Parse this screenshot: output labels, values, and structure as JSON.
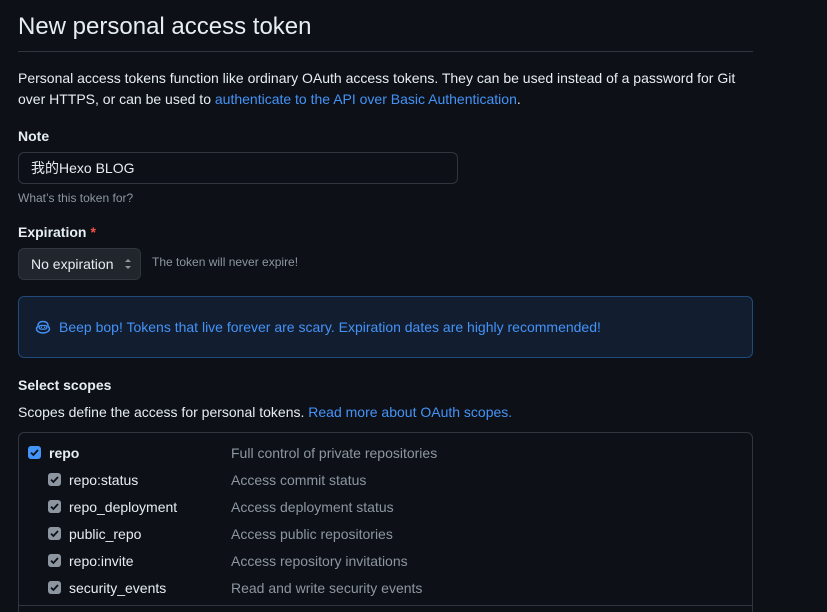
{
  "page": {
    "title": "New personal access token",
    "intro_text": "Personal access tokens function like ordinary OAuth access tokens. They can be used instead of a password for Git over HTTPS, or can be used to ",
    "intro_link": "authenticate to the API over Basic Authentication",
    "intro_end": "."
  },
  "note": {
    "label": "Note",
    "value": "我的Hexo BLOG",
    "hint": "What’s this token for?"
  },
  "expiration": {
    "label": "Expiration",
    "required_mark": "*",
    "selected": "No expiration",
    "hint": "The token will never expire!"
  },
  "flash": {
    "icon": "copilot-icon",
    "message": "Beep bop! Tokens that live forever are scary. Expiration dates are highly recommended!"
  },
  "scopes": {
    "label": "Select scopes",
    "description": "Scopes define the access for personal tokens. ",
    "link": "Read more about OAuth scopes.",
    "items": [
      {
        "name": "repo",
        "description": "Full control of private repositories",
        "checked": true,
        "primary": true
      },
      {
        "name": "repo:status",
        "description": "Access commit status",
        "checked": true,
        "primary": false
      },
      {
        "name": "repo_deployment",
        "description": "Access deployment status",
        "checked": true,
        "primary": false
      },
      {
        "name": "public_repo",
        "description": "Access public repositories",
        "checked": true,
        "primary": false
      },
      {
        "name": "repo:invite",
        "description": "Access repository invitations",
        "checked": true,
        "primary": false
      },
      {
        "name": "security_events",
        "description": "Read and write security events",
        "checked": true,
        "primary": false
      }
    ]
  },
  "colors": {
    "background": "#0d1117",
    "text": "#e6edf3",
    "muted": "#8d96a0",
    "link": "#4493f8",
    "border": "#30363d",
    "danger": "#f85149"
  }
}
